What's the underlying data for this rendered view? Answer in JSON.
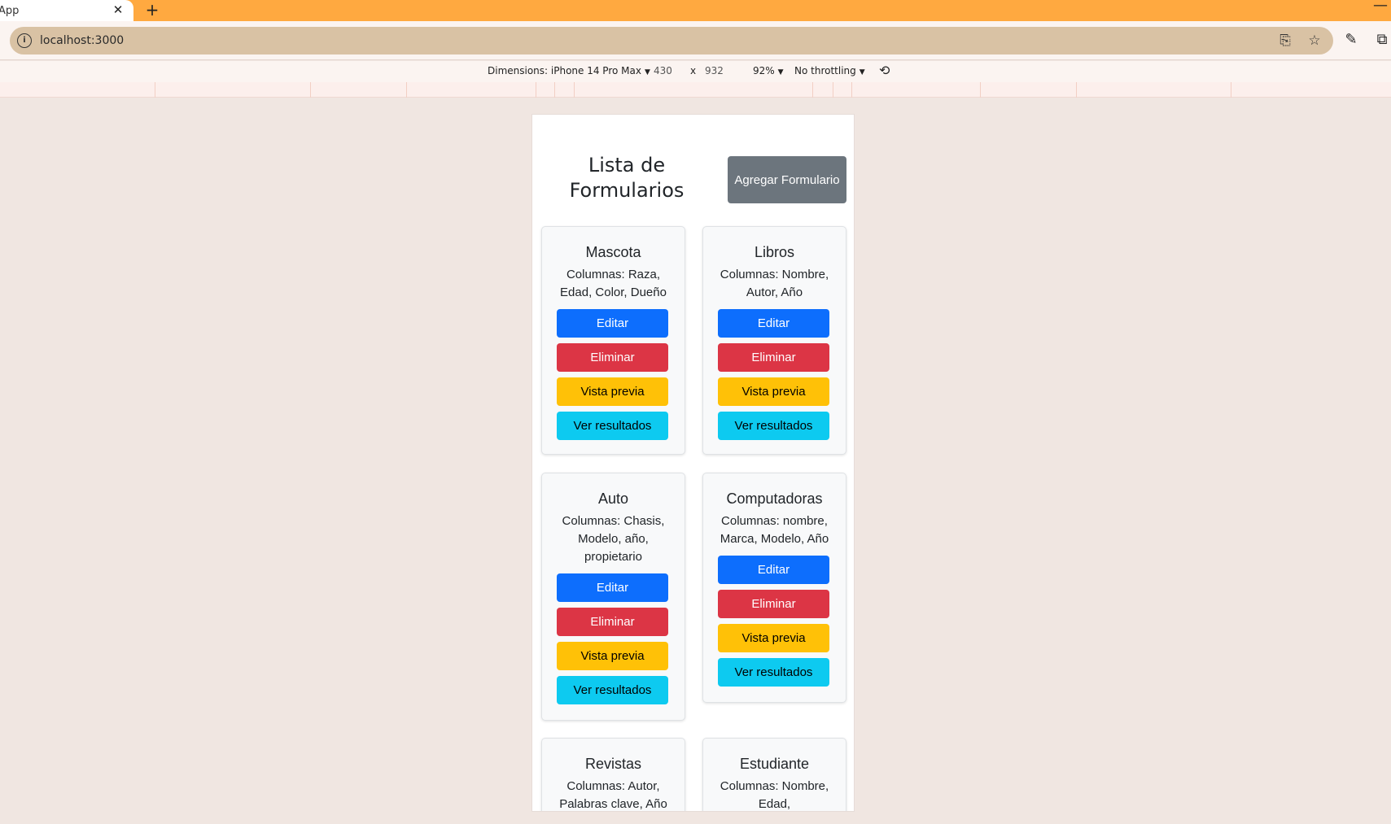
{
  "browser": {
    "tab_title": "App",
    "url": "localhost:3000"
  },
  "devtools": {
    "device_label": "Dimensions: iPhone 14 Pro Max",
    "width": "430",
    "times": "x",
    "height": "932",
    "zoom": "92%",
    "throttling": "No throttling"
  },
  "page": {
    "title": "Lista de Formularios",
    "add_button": "Agregar Formulario"
  },
  "button_labels": {
    "edit": "Editar",
    "delete": "Eliminar",
    "preview": "Vista previa",
    "results": "Ver resultados"
  },
  "forms": [
    {
      "name": "Mascota",
      "columns": "Columnas: Raza, Edad, Color, Dueño"
    },
    {
      "name": "Libros",
      "columns": "Columnas: Nombre, Autor, Año"
    },
    {
      "name": "Auto",
      "columns": "Columnas: Chasis, Modelo, año, propietario"
    },
    {
      "name": "Computadoras",
      "columns": "Columnas: nombre, Marca, Modelo, Año"
    },
    {
      "name": "Revistas",
      "columns": "Columnas: Autor, Palabras clave, Año"
    },
    {
      "name": "Estudiante",
      "columns": "Columnas: Nombre, Edad, Representante,"
    }
  ],
  "colors": {
    "tabstrip": "#ffa940",
    "primary": "#0d6efd",
    "danger": "#dc3545",
    "warning": "#ffc107",
    "info": "#0dcaf0",
    "secondary": "#6c757d"
  }
}
